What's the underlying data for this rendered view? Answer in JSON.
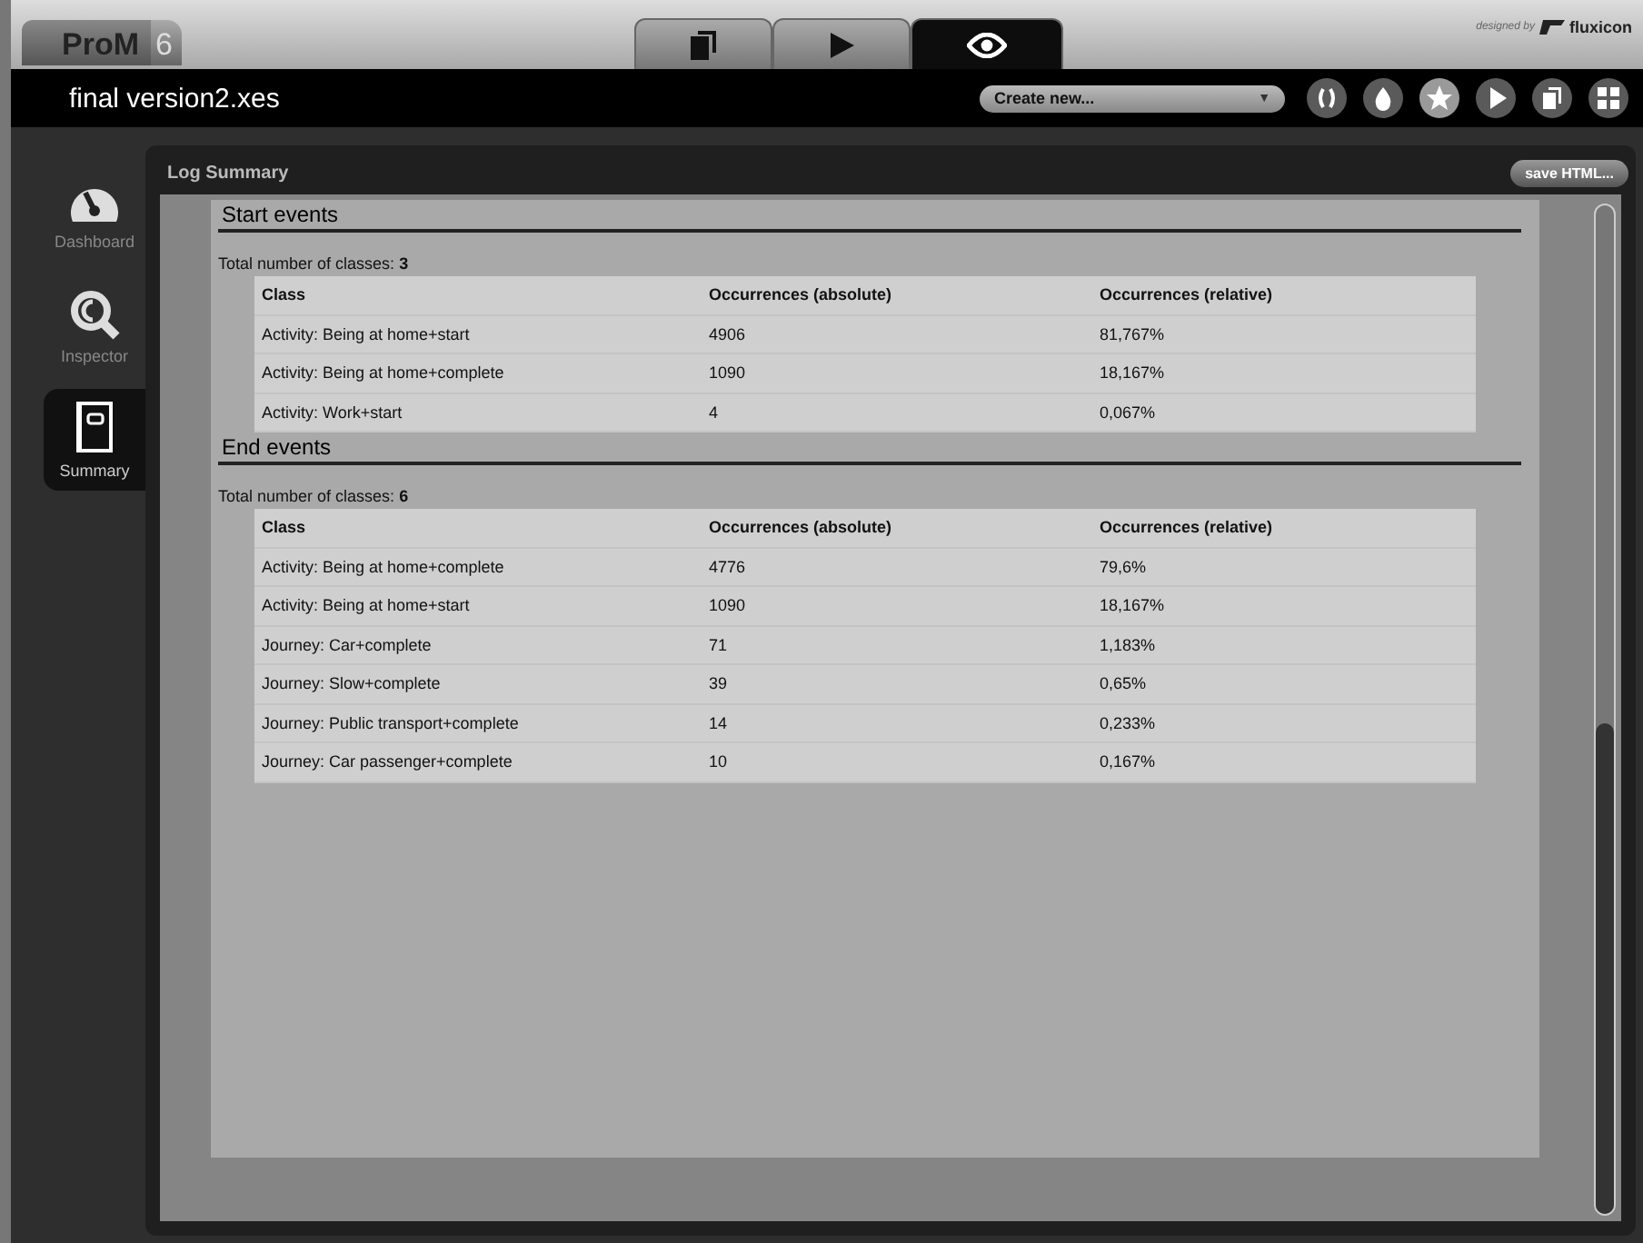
{
  "app": {
    "logo": "ProM",
    "version": "6",
    "credit_prefix": "designed by",
    "credit_brand": "fluxicon"
  },
  "mode_tabs": [
    {
      "kind": "workspace",
      "selected": false
    },
    {
      "kind": "actions",
      "selected": false
    },
    {
      "kind": "views",
      "selected": true
    }
  ],
  "toolbar": {
    "title": "final version2.xes",
    "dropdown": "Create new...",
    "dropdown_caret": "▼",
    "buttons": [
      {
        "kind": "braces"
      },
      {
        "kind": "drop"
      },
      {
        "kind": "star"
      },
      {
        "kind": "play"
      },
      {
        "kind": "copy"
      },
      {
        "kind": "grid"
      }
    ]
  },
  "sidebar": {
    "items": [
      {
        "kind": "dashboard",
        "label": "Dashboard",
        "selected": false
      },
      {
        "kind": "inspector",
        "label": "Inspector",
        "selected": false
      },
      {
        "kind": "summary",
        "label": "Summary",
        "selected": true
      }
    ]
  },
  "panel": {
    "title": "Log Summary",
    "save_button": "save HTML...",
    "sections": [
      {
        "heading": "Start events",
        "total_label": "Total number of classes:",
        "total": "3",
        "columns": [
          "Class",
          "Occurrences (absolute)",
          "Occurrences (relative)"
        ],
        "rows": [
          [
            "Activity: Being at home+start",
            "4906",
            "81,767%"
          ],
          [
            "Activity: Being at home+complete",
            "1090",
            "18,167%"
          ],
          [
            "Activity: Work+start",
            "4",
            "0,067%"
          ]
        ]
      },
      {
        "heading": "End events",
        "total_label": "Total number of classes:",
        "total": "6",
        "columns": [
          "Class",
          "Occurrences (absolute)",
          "Occurrences (relative)"
        ],
        "rows": [
          [
            "Activity: Being at home+complete",
            "4776",
            "79,6%"
          ],
          [
            "Activity: Being at home+start",
            "1090",
            "18,167%"
          ],
          [
            "Journey: Car+complete",
            "71",
            "1,183%"
          ],
          [
            "Journey: Slow+complete",
            "39",
            "0,65%"
          ],
          [
            "Journey: Public transport+complete",
            "14",
            "0,233%"
          ],
          [
            "Journey: Car passenger+complete",
            "10",
            "0,167%"
          ]
        ]
      }
    ]
  }
}
